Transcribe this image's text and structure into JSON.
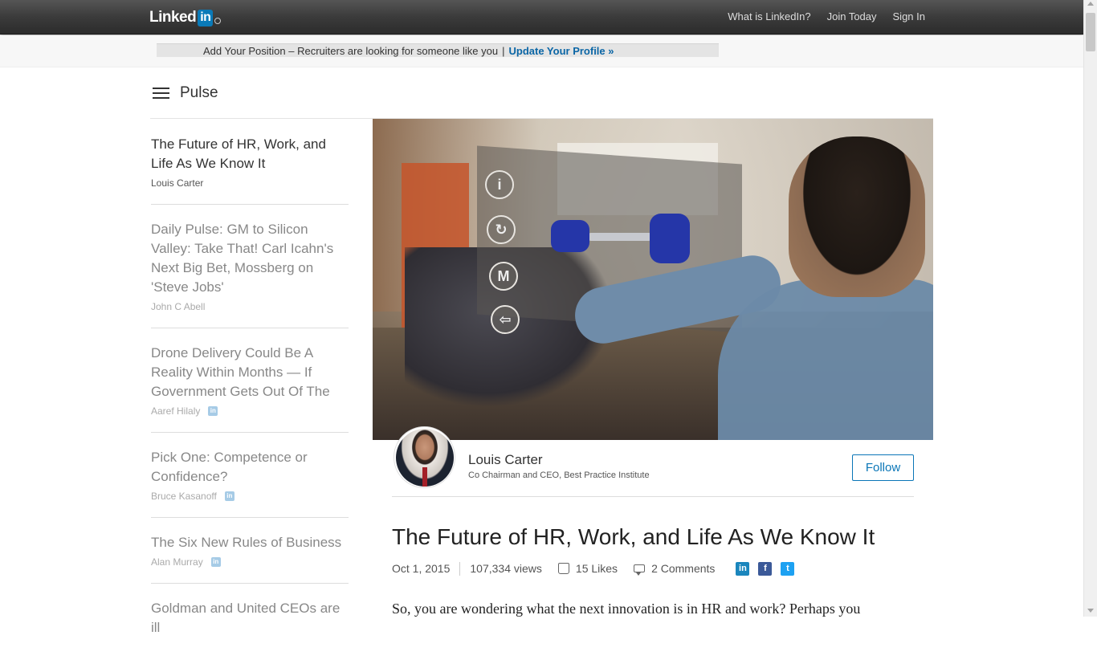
{
  "topbar": {
    "logo_text": "Linked",
    "logo_in": "in",
    "logo_reg": "®",
    "nav": [
      "What is LinkedIn?",
      "Join Today",
      "Sign In"
    ]
  },
  "banner": {
    "text": "Add Your Position – Recruiters are looking for someone like you",
    "separator": "|",
    "link": "Update Your Profile »"
  },
  "pulse": {
    "title": "Pulse"
  },
  "sidebar": {
    "items": [
      {
        "title": "The Future of HR, Work, and Life As We Know It",
        "author": "Louis Carter",
        "badge": false
      },
      {
        "title": "Daily Pulse: GM to Silicon Valley: Take That! Carl Icahn's Next Big Bet, Mossberg on 'Steve Jobs'",
        "author": "John C Abell",
        "badge": false
      },
      {
        "title": "Drone Delivery Could Be A Reality Within Months — If Government Gets Out Of The",
        "author": "Aaref Hilaly",
        "badge": true
      },
      {
        "title": "Pick One: Competence or Confidence?",
        "author": "Bruce Kasanoff",
        "badge": true
      },
      {
        "title": "The Six New Rules of Business",
        "author": "Alan Murray",
        "badge": true
      },
      {
        "title": "Goldman and United CEOs are ill",
        "author": "",
        "badge": false
      }
    ]
  },
  "hero": {
    "panel_icons": [
      "i",
      "↻",
      "M",
      "⇦"
    ]
  },
  "author": {
    "name": "Louis Carter",
    "subtitle": "Co Chairman and CEO, Best Practice Institute",
    "follow_label": "Follow"
  },
  "article": {
    "title": "The Future of HR, Work, and Life As We Know It",
    "date": "Oct 1, 2015",
    "views": "107,334 views",
    "likes": "15 Likes",
    "comments": "2 Comments",
    "body_start": "So, you are wondering what the next innovation is in HR and work? Perhaps you"
  },
  "share": {
    "linkedin": "in",
    "facebook": "f",
    "twitter": "t"
  },
  "colors": {
    "accent": "#0a76b7",
    "topbar": "#3b3b3b",
    "link": "#0b66a6"
  }
}
